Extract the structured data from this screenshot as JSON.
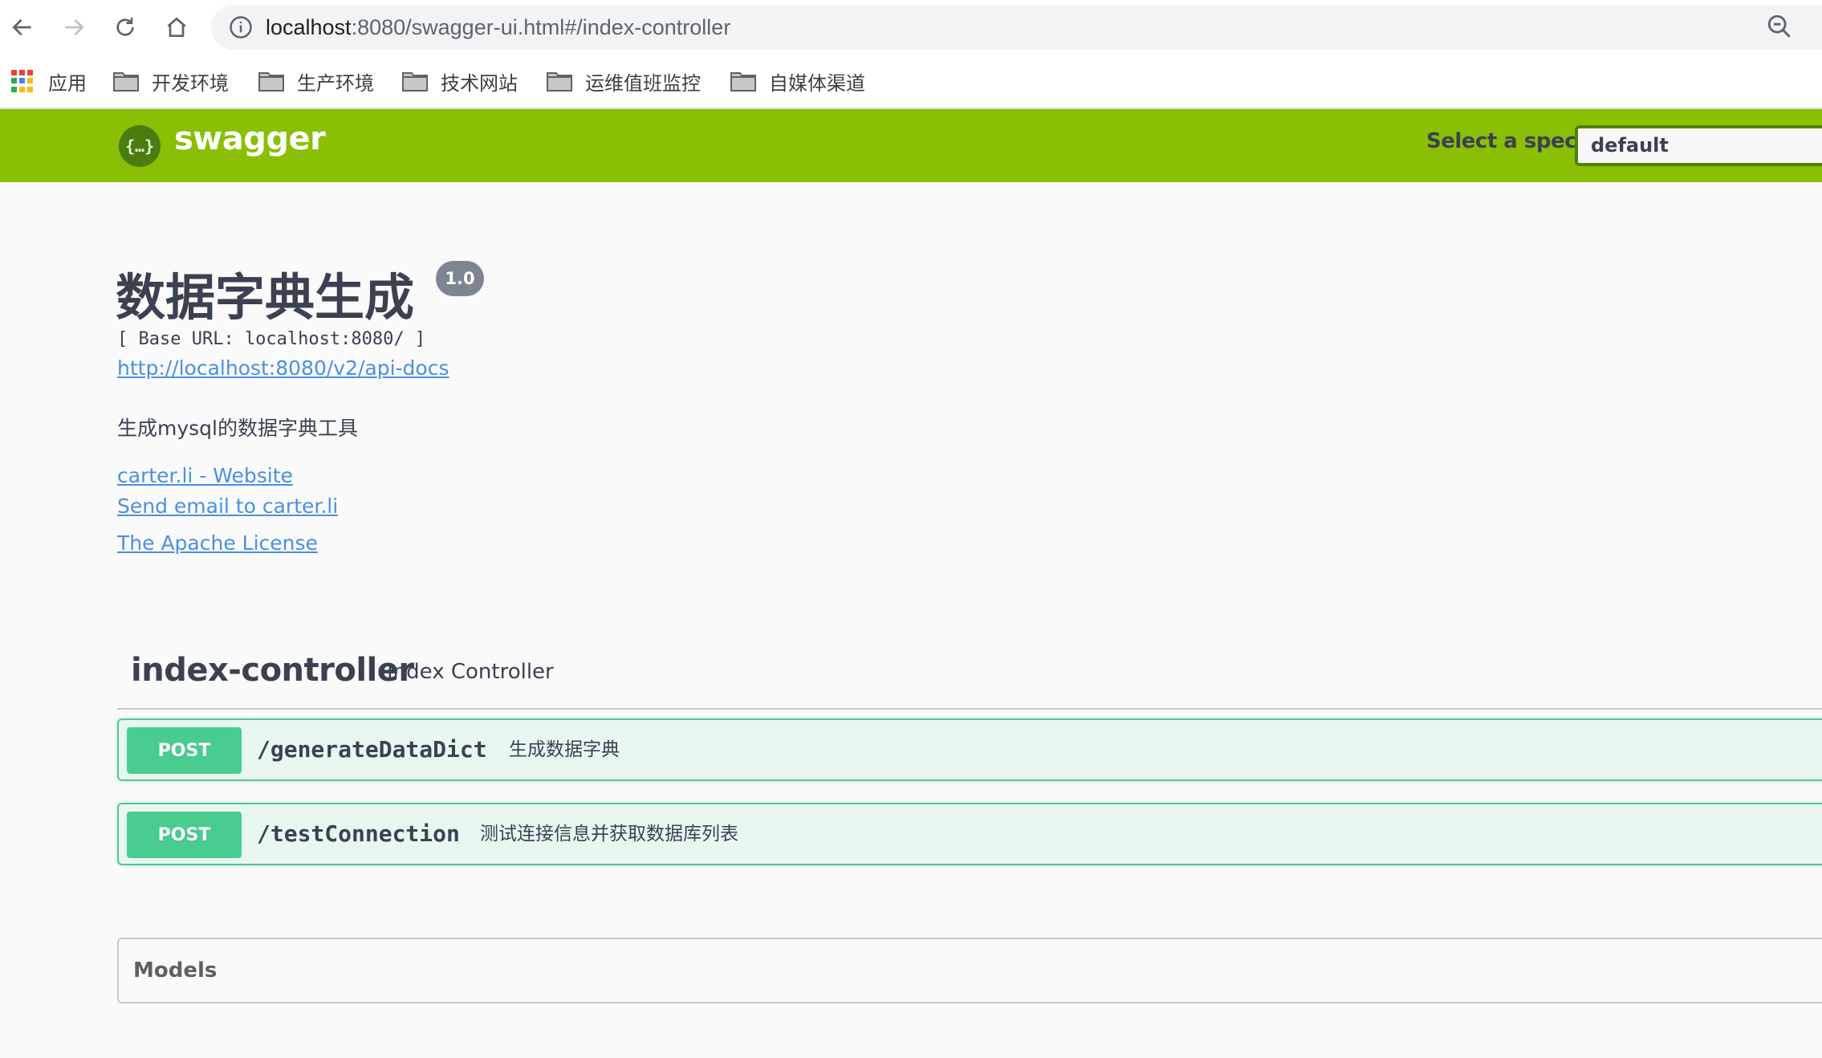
{
  "browser": {
    "url_host": "localhost",
    "url_rest": ":8080/swagger-ui.html#/index-controller",
    "nav": {
      "back": "back-arrow-icon",
      "forward": "forward-arrow-icon",
      "reload": "reload-icon",
      "home": "home-icon"
    },
    "bookmarks": [
      {
        "label": "应用",
        "icon": "apps-grid-icon"
      },
      {
        "label": "开发环境",
        "icon": "folder-icon"
      },
      {
        "label": "生产环境",
        "icon": "folder-icon"
      },
      {
        "label": "技术网站",
        "icon": "folder-icon"
      },
      {
        "label": "运维值班监控",
        "icon": "folder-icon"
      },
      {
        "label": "自媒体渠道",
        "icon": "folder-icon"
      }
    ]
  },
  "topbar": {
    "brand": "swagger",
    "logo_glyph": "{…}",
    "spec_label": "Select a spec",
    "spec_value": "default",
    "color": "#89bf04"
  },
  "info": {
    "title": "数据字典生成",
    "version": "1.0",
    "base_url": "[ Base URL: localhost:8080/ ]",
    "api_docs_link": "http://localhost:8080/v2/api-docs",
    "description": "生成mysql的数据字典工具",
    "contact_website": "carter.li - Website",
    "contact_email": "Send email to carter.li",
    "license": "The Apache License"
  },
  "tag": {
    "name": "index-controller",
    "description": "Index Controller",
    "operations": [
      {
        "method": "POST",
        "path": "/generateDataDict",
        "summary": "生成数据字典"
      },
      {
        "method": "POST",
        "path": "/testConnection",
        "summary": "测试连接信息并获取数据库列表"
      }
    ]
  },
  "models": {
    "title": "Models"
  },
  "colors": {
    "post": "#49cc90",
    "post_bg": "#e8f6f0",
    "link": "#4990e2"
  }
}
